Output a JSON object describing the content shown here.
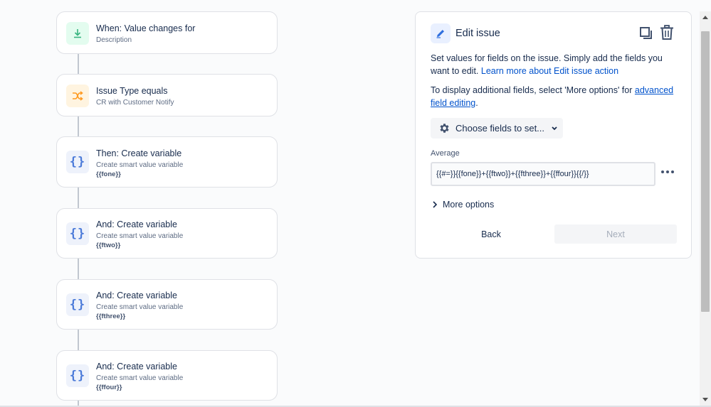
{
  "rule_chain": {
    "trigger": {
      "title": "When: Value changes for",
      "subtitle": "Description",
      "icon": "download-arrow-icon"
    },
    "condition": {
      "title": "Issue Type equals",
      "subtitle": "CR with Customer Notify",
      "icon": "shuffle-icon"
    },
    "actions": [
      {
        "title": "Then: Create variable",
        "subtitle": "Create smart value variable",
        "variable": "{{fone}}"
      },
      {
        "title": "And: Create variable",
        "subtitle": "Create smart value variable",
        "variable": "{{ftwo}}"
      },
      {
        "title": "And: Create variable",
        "subtitle": "Create smart value variable",
        "variable": "{{fthree}}"
      },
      {
        "title": "And: Create variable",
        "subtitle": "Create smart value variable",
        "variable": "{{ffour}}"
      }
    ],
    "action_icon": "{}"
  },
  "panel": {
    "title": "Edit issue",
    "description": "Set values for fields on the issue. Simply add the fields you want to edit.",
    "learn_more_link": "Learn more about Edit issue action",
    "display_text": "To display additional fields, select 'More options' for",
    "advanced_link": "advanced field editing",
    "display_suffix": ".",
    "choose_fields_label": "Choose fields to set...",
    "field_label": "Average",
    "field_value": "{{#=}}{{fone}}+{{ftwo}}+{{fthree}}+{{ffour}}{{/}}",
    "more_options_label": "More options",
    "back_label": "Back",
    "next_label": "Next"
  },
  "colors": {
    "accent": "#0052cc",
    "trigger_icon_bg": "#e3fcef",
    "condition_icon_bg": "#fff4e0",
    "action_icon_bg": "#eef2fb"
  }
}
